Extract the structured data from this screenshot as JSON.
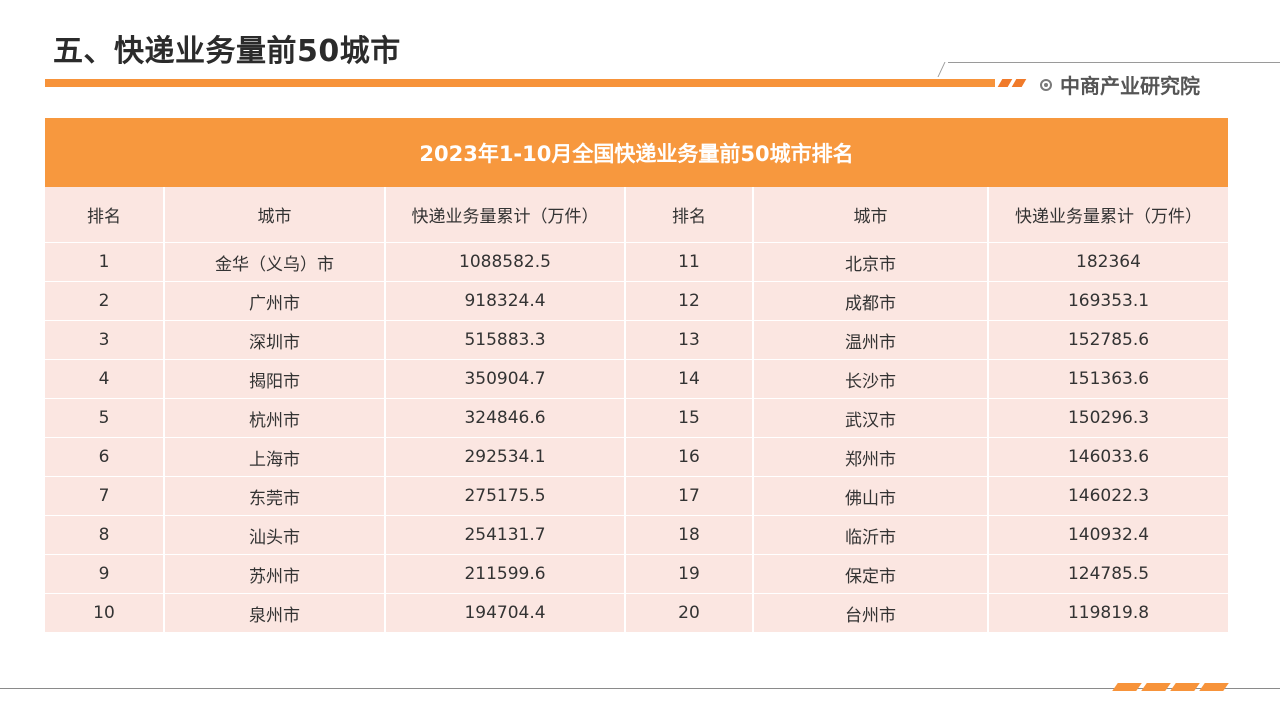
{
  "header": {
    "title": "五、快递业务量前50城市",
    "brand": "中商产业研究院"
  },
  "table": {
    "caption": "2023年1-10月全国快递业务量前50城市排名",
    "headers": [
      "排名",
      "城市",
      "快递业务量累计（万件）",
      "排名",
      "城市",
      "快递业务量累计（万件）"
    ],
    "left": [
      {
        "rank": "1",
        "city": "金华（义乌）市",
        "value": "1088582.5"
      },
      {
        "rank": "2",
        "city": "广州市",
        "value": "918324.4"
      },
      {
        "rank": "3",
        "city": "深圳市",
        "value": "515883.3"
      },
      {
        "rank": "4",
        "city": "揭阳市",
        "value": "350904.7"
      },
      {
        "rank": "5",
        "city": "杭州市",
        "value": "324846.6"
      },
      {
        "rank": "6",
        "city": "上海市",
        "value": "292534.1"
      },
      {
        "rank": "7",
        "city": "东莞市",
        "value": "275175.5"
      },
      {
        "rank": "8",
        "city": "汕头市",
        "value": "254131.7"
      },
      {
        "rank": "9",
        "city": "苏州市",
        "value": "211599.6"
      },
      {
        "rank": "10",
        "city": "泉州市",
        "value": "194704.4"
      }
    ],
    "right": [
      {
        "rank": "11",
        "city": "北京市",
        "value": "182364"
      },
      {
        "rank": "12",
        "city": "成都市",
        "value": "169353.1"
      },
      {
        "rank": "13",
        "city": "温州市",
        "value": "152785.6"
      },
      {
        "rank": "14",
        "city": "长沙市",
        "value": "151363.6"
      },
      {
        "rank": "15",
        "city": "武汉市",
        "value": "150296.3"
      },
      {
        "rank": "16",
        "city": "郑州市",
        "value": "146033.6"
      },
      {
        "rank": "17",
        "city": "佛山市",
        "value": "146022.3"
      },
      {
        "rank": "18",
        "city": "临沂市",
        "value": "140932.4"
      },
      {
        "rank": "19",
        "city": "保定市",
        "value": "124785.5"
      },
      {
        "rank": "20",
        "city": "台州市",
        "value": "119819.8"
      }
    ]
  },
  "theme": {
    "accent": "#f7933a",
    "row_bg": "#fbe6e1"
  }
}
